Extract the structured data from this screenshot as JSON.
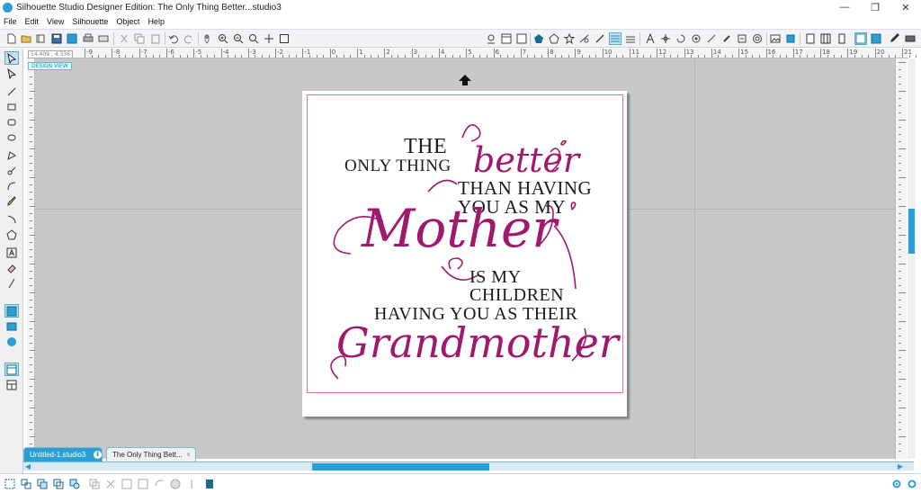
{
  "window": {
    "title": "Silhouette Studio Designer Edition: The Only Thing Better...studio3",
    "controls": [
      "—",
      "❐",
      "✕"
    ]
  },
  "menu": [
    "File",
    "Edit",
    "View",
    "Silhouette",
    "Object",
    "Help"
  ],
  "canvas": {
    "coordinates": "14.409 , 4.336",
    "view_badge": "DESIGN VIEW",
    "ruler_numbers": [
      "-9",
      "-8",
      "-7",
      "-6",
      "-5",
      "-4",
      "-3",
      "-2",
      "-1",
      "0",
      "1",
      "2",
      "3",
      "4",
      "5",
      "6",
      "7",
      "8",
      "9",
      "10",
      "11",
      "12",
      "13",
      "14",
      "15",
      "16",
      "17",
      "18",
      "19",
      "20",
      "21"
    ]
  },
  "design": {
    "line1": "THE",
    "line2": "ONLY THING",
    "word_better": "better",
    "line3": "THAN HAVING",
    "line4": "YOU AS MY",
    "word_mother": "Mother",
    "line5": "IS MY",
    "line6": "CHILDREN",
    "line7": "HAVING YOU AS THEIR",
    "word_grandmother": "Grandmother",
    "accent_color": "#a1196e",
    "text_color": "#1a1a1a",
    "cut_border_color": "#e46f8e"
  },
  "tabs": [
    {
      "label": "Untitled-1.studio3",
      "state": "inactive"
    },
    {
      "label": "The Only Thing Bett...",
      "state": "active"
    }
  ],
  "colors": {
    "brand_blue": "#2a9fd6",
    "canvas_gray": "#c8c8c8"
  }
}
